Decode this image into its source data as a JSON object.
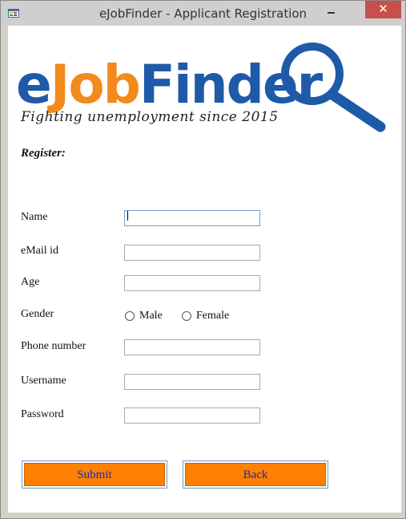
{
  "window": {
    "title": "eJobFinder - Applicant Registration",
    "close_glyph": "✕",
    "min_glyph": "—"
  },
  "logo": {
    "e": "e",
    "job": "Job",
    "finder": "Finder",
    "tagline": "Fighting unemployment since 2015",
    "colors": {
      "blue": "#1e5aa8",
      "orange": "#f28a1c"
    }
  },
  "form": {
    "heading": "Register:",
    "fields": {
      "name": {
        "label": "Name",
        "value": ""
      },
      "email": {
        "label": "eMail id",
        "value": ""
      },
      "age": {
        "label": "Age",
        "value": ""
      },
      "gender": {
        "label": "Gender",
        "options": [
          "Male",
          "Female"
        ]
      },
      "phone": {
        "label": "Phone number",
        "value": ""
      },
      "username": {
        "label": "Username",
        "value": ""
      },
      "password": {
        "label": "Password",
        "value": ""
      }
    },
    "buttons": {
      "submit": "Submit",
      "back": "Back"
    }
  },
  "colors": {
    "button_fill": "#ff8000",
    "button_text": "#1a2ab0",
    "close_button": "#c7504a"
  }
}
